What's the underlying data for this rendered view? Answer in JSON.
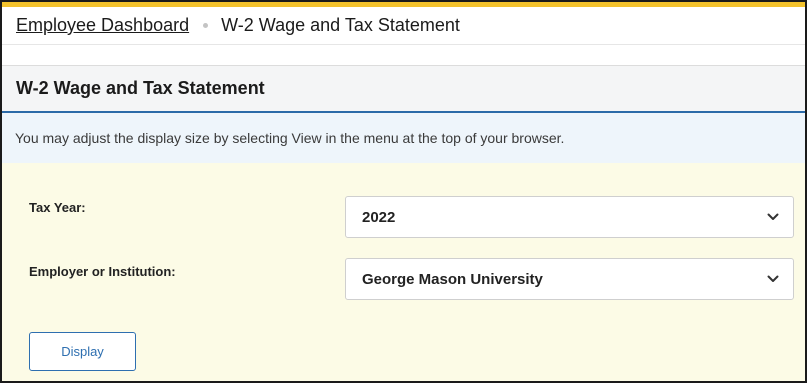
{
  "breadcrumb": {
    "home_label": "Employee Dashboard",
    "current_label": "W-2 Wage and Tax Statement"
  },
  "page": {
    "title": "W-2 Wage and Tax Statement",
    "notice": "You may adjust the display size by selecting View in the menu at the top of your browser."
  },
  "form": {
    "tax_year": {
      "label": "Tax Year:",
      "selected_value": "2022"
    },
    "employer": {
      "label": "Employer or Institution:",
      "selected_value": "George Mason University"
    },
    "display_button_label": "Display"
  },
  "icons": {
    "dropdown": "chevron-down-icon"
  },
  "colors": {
    "accent_gold": "#f3c22c",
    "link_blue": "#2e6fb0",
    "title_underline": "#2b6aa8",
    "form_background": "#fcfbe6",
    "notice_background": "#eef5fb"
  }
}
